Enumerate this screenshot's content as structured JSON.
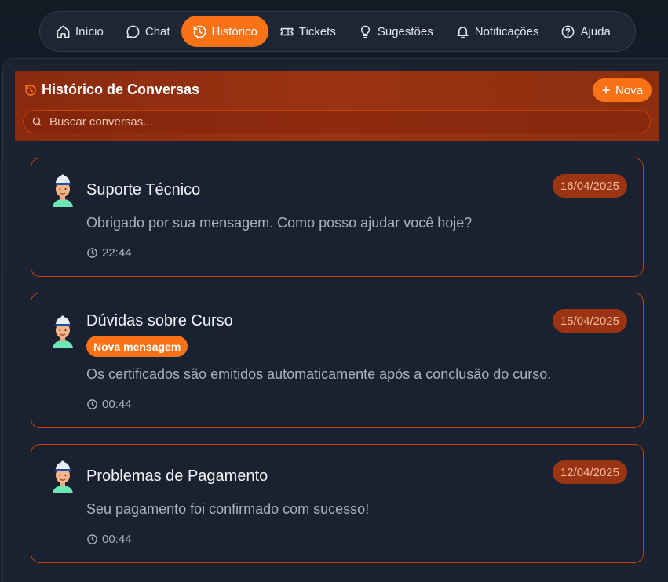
{
  "nav": {
    "items": [
      {
        "label": "Início",
        "icon": "home-icon"
      },
      {
        "label": "Chat",
        "icon": "chat-bubble-icon"
      },
      {
        "label": "Histórico",
        "icon": "history-icon",
        "active": true
      },
      {
        "label": "Tickets",
        "icon": "ticket-icon"
      },
      {
        "label": "Sugestões",
        "icon": "lightbulb-icon"
      },
      {
        "label": "Notificações",
        "icon": "bell-icon"
      },
      {
        "label": "Ajuda",
        "icon": "help-circle-icon"
      }
    ]
  },
  "header": {
    "title": "Histórico de Conversas",
    "new_label": "Nova",
    "search_placeholder": "Buscar conversas..."
  },
  "conversations": [
    {
      "title": "Suporte Técnico",
      "date": "16/04/2025",
      "badge": "",
      "message": "Obrigado por sua mensagem. Como posso ajudar você hoje?",
      "time": "22:44"
    },
    {
      "title": "Dúvidas sobre Curso",
      "date": "15/04/2025",
      "badge": "Nova mensagem",
      "message": "Os certificados são emitidos automaticamente após a conclusão do curso.",
      "time": "00:44"
    },
    {
      "title": "Problemas de Pagamento",
      "date": "12/04/2025",
      "badge": "",
      "message": "Seu pagamento foi confirmado com sucesso!",
      "time": "00:44"
    }
  ],
  "colors": {
    "accent": "#f97316",
    "header_bg": "#9a3312",
    "card_border": "#c2410c",
    "date_badge_bg": "#9a3412"
  }
}
